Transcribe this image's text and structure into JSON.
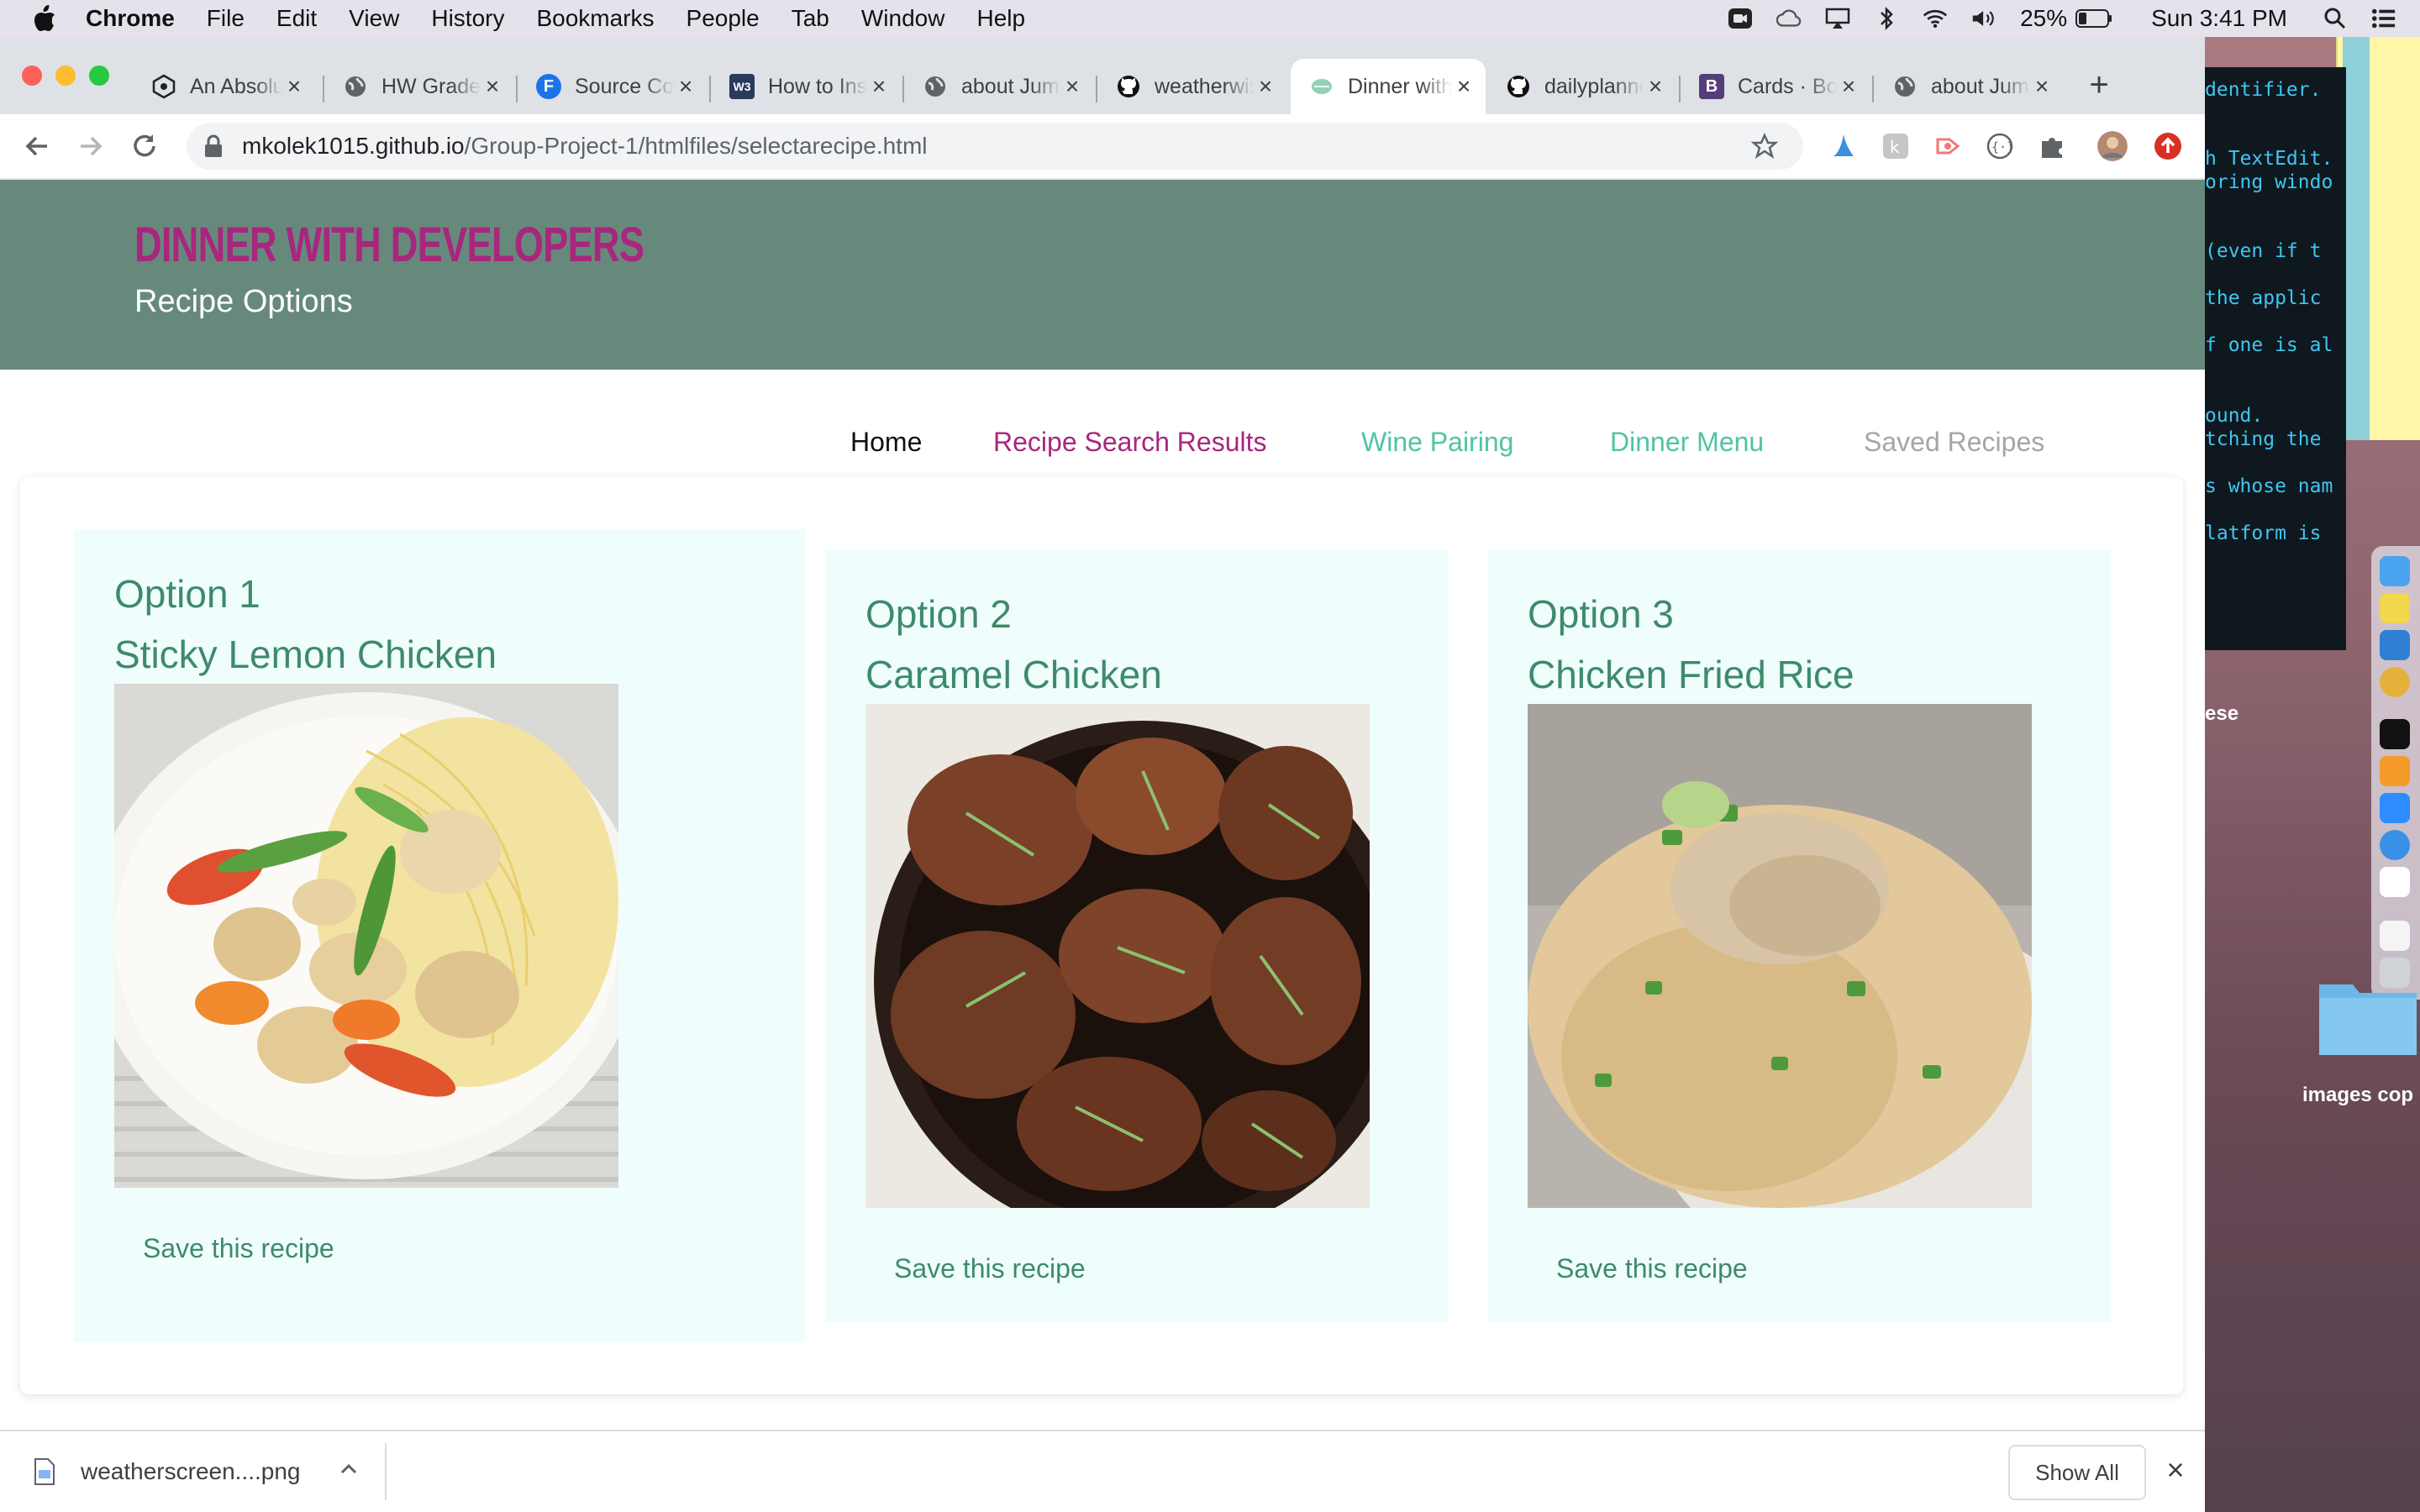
{
  "menubar": {
    "app": "Chrome",
    "items": [
      "File",
      "Edit",
      "View",
      "History",
      "Bookmarks",
      "People",
      "Tab",
      "Window",
      "Help"
    ],
    "battery": "25%",
    "clock": "Sun 3:41 PM"
  },
  "browser": {
    "tabs": [
      {
        "title": "An Absolute Beginner's Guide",
        "icon": "hex-logo-icon"
      },
      {
        "title": "HW Grades",
        "icon": "globe-icon"
      },
      {
        "title": "Source Code",
        "icon": "f-logo-icon"
      },
      {
        "title": "How to Install",
        "icon": "w3-logo-icon"
      },
      {
        "title": "about Jump",
        "icon": "globe-icon"
      },
      {
        "title": "weatherwise",
        "icon": "github-icon"
      },
      {
        "title": "Dinner with Developers",
        "icon": "leaf-icon"
      },
      {
        "title": "dailyplanner",
        "icon": "github-icon"
      },
      {
        "title": "Cards · Bootstrap",
        "icon": "bootstrap-icon"
      },
      {
        "title": "about Jump",
        "icon": "globe-icon"
      }
    ],
    "active_tab": 6,
    "url_domain": "mkolek1015.github.io",
    "url_path": "/Group-Project-1/htmlfiles/selectarecipe.html"
  },
  "page": {
    "site_title": "DINNER WITH DEVELOPERS",
    "subtitle": "Recipe Options",
    "nav": [
      {
        "label": "Home",
        "color": "#111111"
      },
      {
        "label": "Recipe Search Results",
        "color": "#a8267e"
      },
      {
        "label": "Wine Pairing",
        "color": "#4fc4a4"
      },
      {
        "label": "Dinner Menu",
        "color": "#4fc4a4"
      },
      {
        "label": "Saved Recipes",
        "color": "#a5a5a5"
      }
    ],
    "recipes": [
      {
        "option": "Option 1",
        "name": "Sticky Lemon Chicken",
        "save": "Save this recipe"
      },
      {
        "option": "Option 2",
        "name": "Caramel Chicken",
        "save": "Save this recipe"
      },
      {
        "option": "Option 3",
        "name": "Chicken Fried Rice",
        "save": "Save this recipe"
      }
    ],
    "colors": {
      "hero": "#67897b",
      "title": "#a8267e",
      "card": "#effefc",
      "card_text": "#3e8a6c"
    }
  },
  "downloads": {
    "file": "weatherscreen....png",
    "show_all": "Show All"
  },
  "desktop": {
    "terminal_lines": [
      "dentifier.",
      "h TextEdit.",
      "oring windo",
      "(even if t",
      "the applic",
      "f one is al",
      "ound.",
      "tching the",
      "s whose nam",
      "latform is"
    ],
    "side_label": "ese",
    "folder_label": "images cop"
  }
}
